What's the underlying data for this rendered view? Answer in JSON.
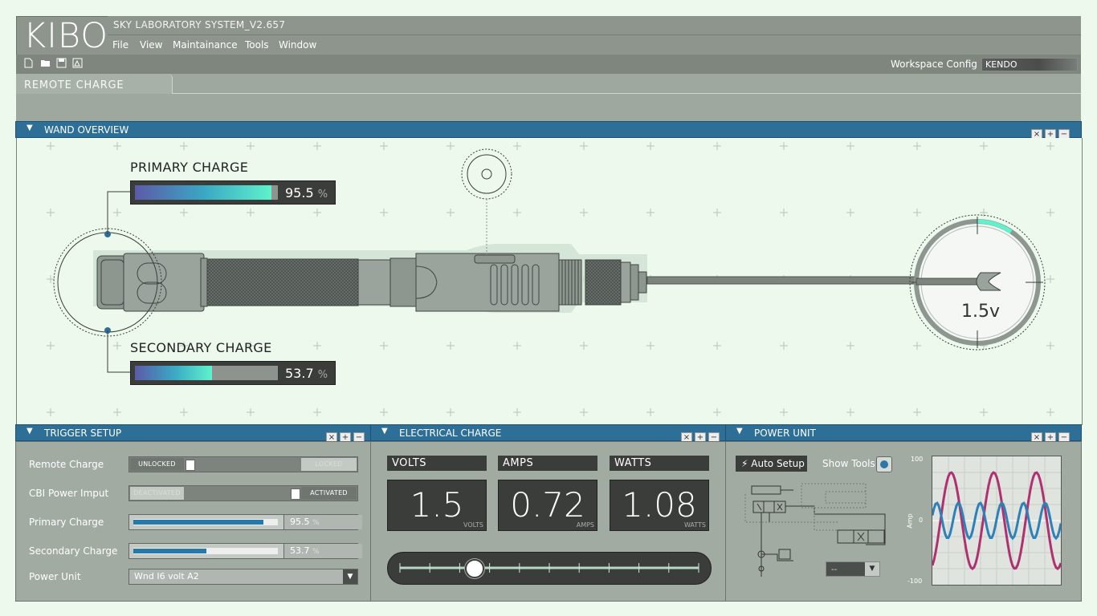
{
  "app": {
    "logo": "KIBO",
    "title": "SKY LABORATORY SYSTEM_V2.657"
  },
  "menu": [
    "File",
    "View",
    "Maintainance",
    "Tools",
    "Window"
  ],
  "toolbar": {
    "icons": [
      "new-file-icon",
      "open-folder-icon",
      "save-icon",
      "export-icon"
    ],
    "workspace_label": "Workspace Config",
    "workspace_value": "KENDO"
  },
  "tabs": [
    {
      "label": "REMOTE CHARGE",
      "active": true
    }
  ],
  "wand_overview": {
    "title": "WAND OVERVIEW",
    "primary": {
      "label": "PRIMARY CHARGE",
      "value": "95.5",
      "unit": "%",
      "fraction": 0.955
    },
    "secondary": {
      "label": "SECONDARY CHARGE",
      "value": "53.7",
      "unit": "%",
      "fraction": 0.537
    },
    "tip_voltage": "1.5v"
  },
  "window_buttons": {
    "close": "×",
    "add": "+",
    "minimize": "−"
  },
  "trigger_setup": {
    "title": "TRIGGER SETUP",
    "rows": {
      "remote_charge": {
        "label": "Remote Charge",
        "left": "UNLOCKED",
        "right": "LOCKED"
      },
      "cbi_power": {
        "label": "CBI Power Imput",
        "left": "DEACTIVATED",
        "right": "ACTIVATED"
      },
      "primary": {
        "label": "Primary Charge",
        "value": "95.5",
        "unit": "%",
        "fraction": 0.955
      },
      "secondary": {
        "label": "Secondary Charge",
        "value": "53.7",
        "unit": "%",
        "fraction": 0.537
      },
      "power_unit": {
        "label": "Power Unit",
        "value": "Wnd I6 volt A2"
      }
    }
  },
  "electrical_charge": {
    "title": "ELECTRICAL CHARGE",
    "volts": {
      "label": "VOLTS",
      "value": "1.5",
      "unit": "VOLTS"
    },
    "amps": {
      "label": "AMPS",
      "value": "0.72",
      "unit": "AMPS"
    },
    "watts": {
      "label": "WATTS",
      "value": "1.08",
      "unit": "WATTS"
    },
    "slider_fraction": 0.25
  },
  "power_unit": {
    "title": "POWER UNIT",
    "auto_setup": "Auto Setup",
    "show_tools": "Show Tools",
    "select_value": "--",
    "graph": {
      "y_top": "100",
      "y_mid": "0",
      "y_bottom": "-100",
      "y_label": "Amp"
    }
  },
  "colors": {
    "header_blue": "#2d6f97",
    "accent_teal": "#5ff2cc",
    "wave_magenta": "#b03070",
    "wave_blue": "#2e80b8"
  }
}
